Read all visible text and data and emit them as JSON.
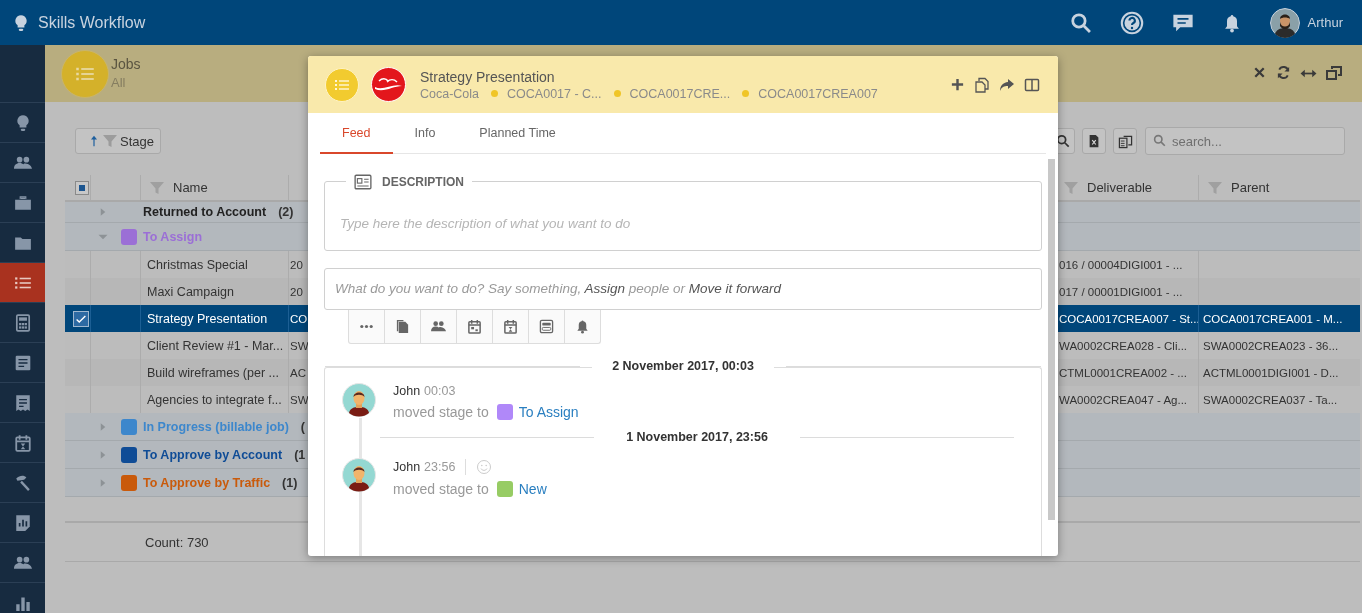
{
  "app_bar": {
    "title": "Skills Workflow",
    "user": "Arthur"
  },
  "sidebar": {
    "items": [
      {
        "selected": false
      },
      {
        "selected": false
      },
      {
        "selected": false
      },
      {
        "selected": false
      },
      {
        "selected": true
      },
      {
        "selected": false
      },
      {
        "selected": false
      },
      {
        "selected": false
      },
      {
        "selected": false
      },
      {
        "selected": false
      },
      {
        "selected": false
      },
      {
        "selected": false
      },
      {
        "selected": false
      }
    ]
  },
  "page_header": {
    "title": "Jobs",
    "subtitle": "All"
  },
  "toolbar": {
    "sort_label": "Stage",
    "search": {
      "placeholder": "search..."
    }
  },
  "table": {
    "select_all": {
      "indeterminate": true
    },
    "columns": [
      "Name",
      "Deliverable",
      "Parent"
    ],
    "rows": [
      {
        "kind": "group",
        "label": "Returned to Account",
        "count": "(2)",
        "expanded": false
      },
      {
        "kind": "group",
        "label": "To Assign",
        "color": "#9b6fd6",
        "expanded": true
      },
      {
        "kind": "item",
        "name": "Christmas Special",
        "column_4": "20",
        "deliverable": "016 / 00004DIGI001 - ...",
        "selected": false
      },
      {
        "kind": "item",
        "name": "Maxi Campaign",
        "column_4": "20",
        "deliverable": "017 / 00001DIGI001 - ...",
        "selected": false
      },
      {
        "kind": "item",
        "name": "Strategy Presentation",
        "column_4": "CO",
        "deliverable": "COCA0017CREA007 - St...",
        "parent": "COCA0017CREA001 - M...",
        "selected": true
      },
      {
        "kind": "item",
        "name": "Client Review #1 - Mar...",
        "column_4": "SW",
        "deliverable": "WA0002CREA028 - Cli...",
        "parent": "SWA0002CREA023 - 36...",
        "selected": false
      },
      {
        "kind": "item",
        "name": "Build wireframes (per ...",
        "column_4": "AC",
        "deliverable": "CTML0001CREA002 - ...",
        "parent": "ACTML0001DIGI001 - D...",
        "selected": false
      },
      {
        "kind": "item",
        "name": "Agencies to integrate f...",
        "column_4": "SW",
        "deliverable": "WA0002CREA047 - Ag...",
        "parent": "SWA0002CREA037 - Ta...",
        "selected": false
      },
      {
        "kind": "group",
        "label": "In Progress (billable job)",
        "count": "(",
        "color": "#3d87cc",
        "expanded": false
      },
      {
        "kind": "group",
        "label": "To Approve by Account",
        "count": "(1",
        "color": "#0f4c96",
        "expanded": false
      },
      {
        "kind": "group",
        "label": "To Approve by Traffic",
        "count": "(1)",
        "color": "#c95a0b",
        "expanded": false
      }
    ],
    "count_label": "Count: 730"
  },
  "job_panel": {
    "title": "Strategy Presentation",
    "breadcrumbs": [
      "Coca-Cola",
      "COCA0017 - C...",
      "COCA0017CRE...",
      "COCA0017CREA007"
    ],
    "tabs": [
      {
        "label": "Feed",
        "selected": true
      },
      {
        "label": "Info",
        "selected": false
      },
      {
        "label": "Planned Time",
        "selected": false
      }
    ],
    "description": {
      "label": "DESCRIPTION",
      "placeholder": "Type here the description of what you want to do"
    },
    "composer": {
      "prompt": "What do you want to do? Say something, **Assign** people or **Move it forward**"
    },
    "feed": [
      {
        "kind": "date",
        "label": "2 November 2017, 00:03"
      },
      {
        "kind": "activity",
        "author": "John",
        "time": "00:03",
        "action": "moved stage to",
        "stage": "To Assign",
        "color": "#b088f9",
        "can_react": false
      },
      {
        "kind": "date",
        "label": "1 November 2017, 23:56"
      },
      {
        "kind": "activity",
        "author": "John",
        "time": "23:56",
        "action": "moved stage to",
        "stage": "New",
        "color": "#97cc64",
        "can_react": true
      }
    ]
  }
}
